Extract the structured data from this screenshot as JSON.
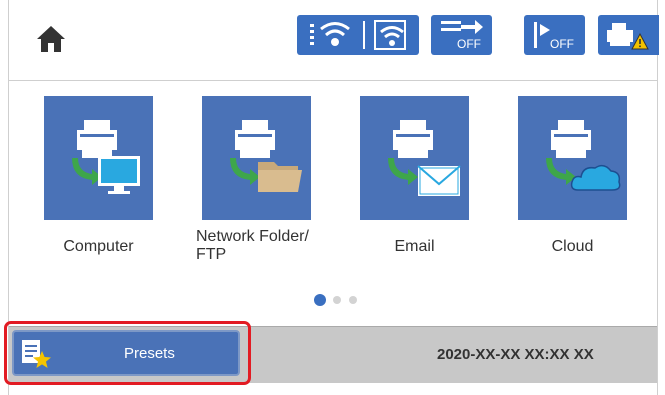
{
  "colors": {
    "accent": "#3a6fc0",
    "tile": "#4a72b7",
    "highlight": "#e21b23",
    "bottom_bar": "#c8c8c8"
  },
  "header": {
    "status_icons": [
      {
        "name": "wifi-off-icon"
      },
      {
        "name": "wifi-direct-icon"
      },
      {
        "name": "fax-forward-off-icon",
        "text": "OFF"
      },
      {
        "name": "quiet-mode-off-icon",
        "text": "OFF"
      },
      {
        "name": "printer-warning-icon"
      }
    ]
  },
  "tiles": [
    {
      "label": "Computer",
      "icon": "computer-icon"
    },
    {
      "label": "Network Folder/\nFTP",
      "icon": "network-folder-icon"
    },
    {
      "label": "Email",
      "icon": "email-icon"
    },
    {
      "label": "Cloud",
      "icon": "cloud-icon"
    }
  ],
  "pagination": {
    "pages": 3,
    "current": 1
  },
  "footer": {
    "presets_label": "Presets",
    "datetime": "2020-XX-XX XX:XX XX"
  }
}
